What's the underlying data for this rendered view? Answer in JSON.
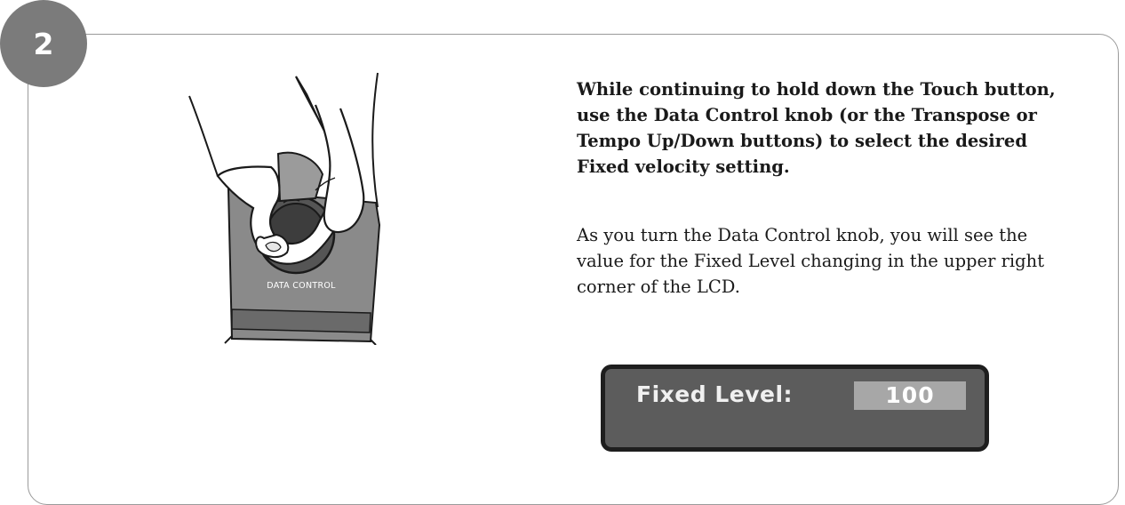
{
  "step": {
    "number": "2"
  },
  "illustration": {
    "knob_label": "DATA CONTROL",
    "depicts": "hand-turning-knob-icon"
  },
  "instruction": {
    "text": "While continuing to hold down the Touch button, use the Data Control knob (or the Transpose or Tempo Up/Down buttons) to select the desired Fixed velocity setting."
  },
  "description": {
    "text": "As you turn the Data Control knob, you will see the value for the Fixed Level changing in the upper right corner of the LCD."
  },
  "lcd": {
    "label": "Fixed Level:",
    "value": "100"
  },
  "colors": {
    "badge": "#7b7b7b",
    "lcd_background": "#5c5c5c",
    "lcd_border": "#1e1e1e",
    "lcd_value_background": "#a7a7a7",
    "panel_border": "#9a9a9a"
  }
}
